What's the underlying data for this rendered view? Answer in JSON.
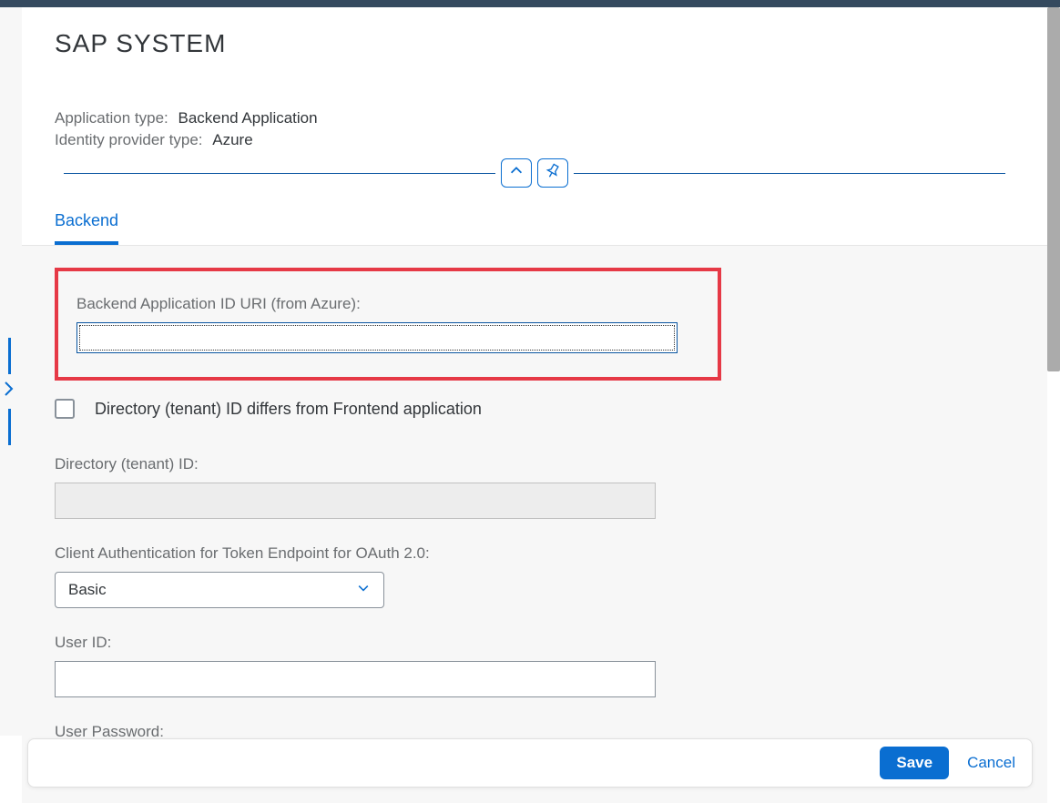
{
  "header": {
    "title": "SAP SYSTEM",
    "app_type_label": "Application type:",
    "app_type_value": "Backend Application",
    "idp_type_label": "Identity provider type:",
    "idp_type_value": "Azure"
  },
  "tabs": {
    "backend": "Backend"
  },
  "form": {
    "backend_uri_label": "Backend Application ID URI (from Azure):",
    "backend_uri_value": "",
    "tenant_diff_label": "Directory (tenant) ID differs from Frontend application",
    "tenant_id_label": "Directory (tenant) ID:",
    "tenant_id_value": "",
    "client_auth_label": "Client Authentication for Token Endpoint for OAuth 2.0:",
    "client_auth_value": "Basic",
    "user_id_label": "User ID:",
    "user_id_value": "",
    "user_password_label": "User Password:"
  },
  "footer": {
    "save": "Save",
    "cancel": "Cancel"
  }
}
